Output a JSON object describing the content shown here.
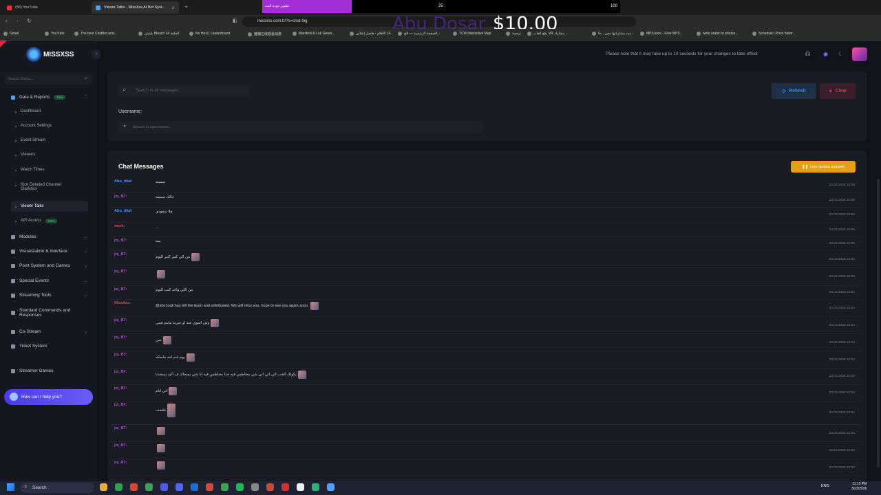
{
  "browser": {
    "tabs": [
      {
        "title": "(58) YouTube"
      },
      {
        "title": "Viewer Talks - MissXss AI Bot Syst..."
      }
    ],
    "url": "missxss.com.tr/?s=chat-log",
    "bookmarks": [
      "Gmail",
      "YouTube",
      "The best ChatBot and...",
      "بليتش Bleach الحلقة 14",
      "No Hesi | Leaderboard",
      "猪猪在线观看动漫",
      "Manifest & Lua Gener...",
      "الأفلام - فاصل إعلاني | F...",
      "الصفحة الرئيسية — الح...",
      "TCM Interactive Map",
      "ترجمة",
      "بكج العاب VR مشارك ...",
      "G... نبت مشاركتها معي -",
      "MP3Juice - Free MP3...",
      "write arabic in photos...",
      "Schedule | Price histor..."
    ]
  },
  "overlay": {
    "purple_text": "تطوير جودة البث",
    "mid_number": "25",
    "right_number": "100",
    "donor_name": "Abu Dosar",
    "amount": "$10.00"
  },
  "sidebar": {
    "brand": "MISSXSS",
    "search_placeholder": "Search Menu...",
    "group": {
      "label": "Data & Reports",
      "badge": "New"
    },
    "sub_items": [
      "Dashboard",
      "Account Settings",
      "Event Stream",
      "Viewers",
      "Watch Times",
      "Kick Detailed Channel Statistics",
      "Viewer Talks",
      "API Access"
    ],
    "api_badge": "New",
    "items": [
      "Modules",
      "Visualization & Interface",
      "Point System and Games",
      "Special Events",
      "Streaming Tools",
      "Standard Commands and Responses",
      "Co-Stream",
      "Ticket System",
      "Streamer Games"
    ],
    "help": "How can I help you?"
  },
  "header": {
    "notice": "Please note that it may take up to 10 seconds for your changes to take effect"
  },
  "filters": {
    "search_placeholder": "Search in all messages...",
    "username_label": "Username:",
    "username_placeholder": "Search in usernames...",
    "refresh": "Refresh",
    "clear": "Clear"
  },
  "chat": {
    "title": "Chat Messages",
    "live_status": "Live update stopped",
    "messages": [
      {
        "user": "Abu_diial:",
        "text": "مسيته",
        "time": "23.03.2026 22:58",
        "color": "#3d9bff"
      },
      {
        "user": "joj_B7:",
        "text": "جالك مسيته",
        "time": "23.03.2026 22:58",
        "color": "#a955d9"
      },
      {
        "user": "Abu_diial:",
        "text": "هلا سعودي",
        "time": "23.03.2026 22:58",
        "color": "#3d9bff"
      },
      {
        "user": "ewvk:",
        "text": "..",
        "time": "23.03.2026 22:56",
        "color": "#e0475e"
      },
      {
        "user": "joj_B7:",
        "text": "يمه",
        "time": "23.03.2026 22:56",
        "color": "#a955d9"
      },
      {
        "user": "joj_B7:",
        "text": "من الي كثير كثير اليوم",
        "time": "23.03.2026 22:56",
        "color": "#a955d9"
      },
      {
        "user": "joj_B7:",
        "text": "",
        "time": "23.03.2026 22:55",
        "color": "#a955d9"
      },
      {
        "user": "joj_B7:",
        "text": "من اللي واحد كتب اليوم",
        "time": "23.03.2026 22:55",
        "color": "#a955d9"
      },
      {
        "user": "MissXss:",
        "text": "@sho1uqli has left the team and unfollowed. We will miss you, hope to see you again soon.",
        "time": "23.03.2026 22:54",
        "color": "#e0475e"
      },
      {
        "user": "joj_B7:",
        "text": "وش اسوي عند او عيرته ماينم فيني",
        "time": "23.03.2026 22:54",
        "color": "#a955d9"
      },
      {
        "user": "joj_B7:",
        "text": "سن",
        "time": "23.03.2026 22:54",
        "color": "#a955d9"
      },
      {
        "user": "joj_B7:",
        "text": "يوم ادم احد ماسكه",
        "time": "23.03.2026 22:52",
        "color": "#a955d9"
      },
      {
        "user": "joj_B7:",
        "text": "يكولك الحب الي اني اني شي مخاطس فيه حدا مخاطس فيه انا شي يسحاك ف اكيد يسحدنا",
        "time": "23.03.2026 22:52",
        "color": "#a955d9"
      },
      {
        "user": "joj_B7:",
        "text": "اني انام",
        "time": "23.03.2026 22:52",
        "color": "#a955d9"
      },
      {
        "user": "joj_B7:",
        "text": "خلصت",
        "time": "23.03.2026 22:51",
        "color": "#a955d9"
      },
      {
        "user": "joj_B7:",
        "text": "",
        "time": "23.03.2026 22:50",
        "color": "#a955d9"
      },
      {
        "user": "joj_B7:",
        "text": "",
        "time": "23.03.2026 22:50",
        "color": "#a955d9"
      },
      {
        "user": "joj_B7:",
        "text": "",
        "time": "23.03.2026 22:50",
        "color": "#a955d9"
      }
    ]
  },
  "taskbar": {
    "search": "Search",
    "lang": "ENG",
    "time": "11:13 PM",
    "date": "3/23/2026"
  }
}
